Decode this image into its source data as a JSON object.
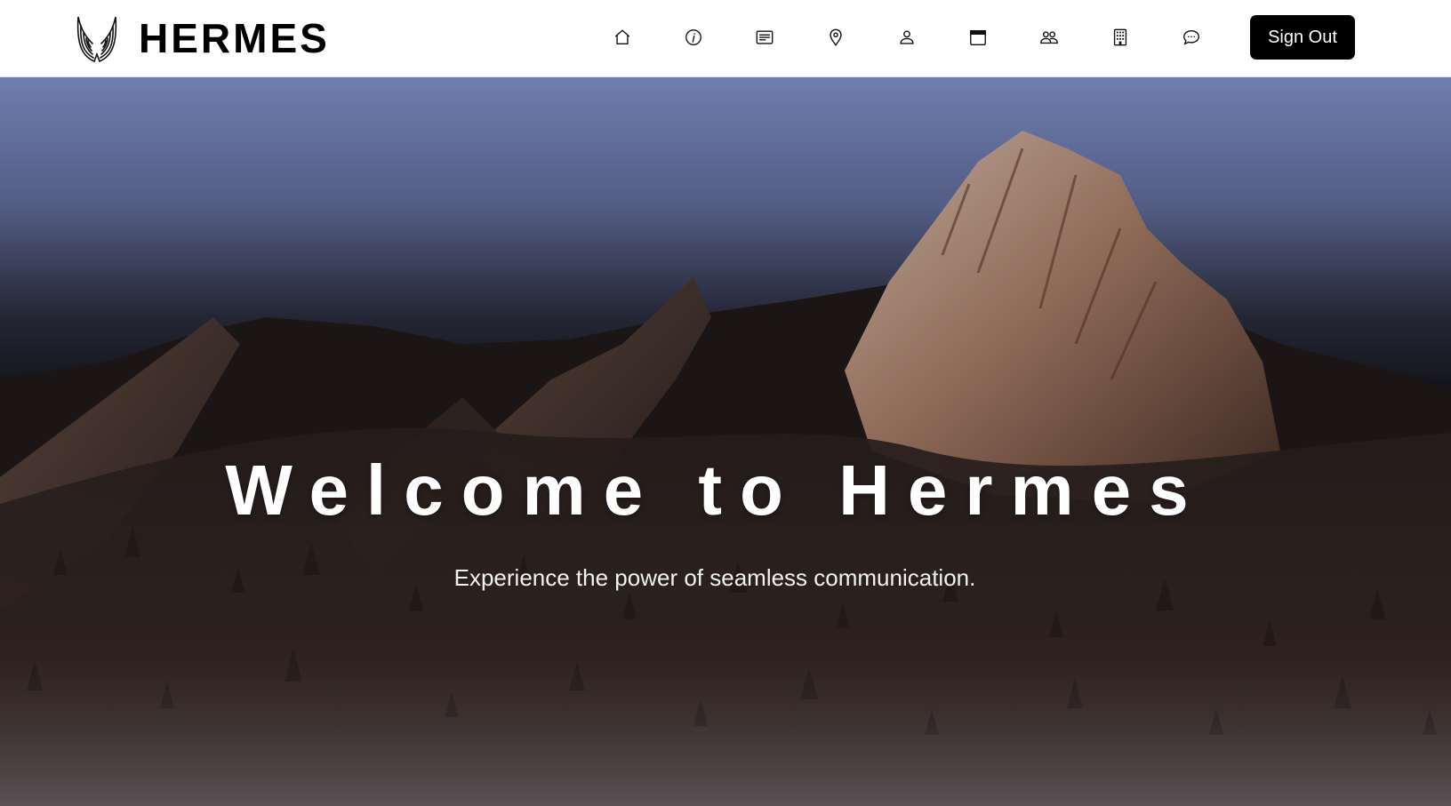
{
  "brand": {
    "name": "HERMES"
  },
  "nav": {
    "icons": [
      "home-icon",
      "info-icon",
      "message-icon",
      "location-pin-icon",
      "user-icon",
      "calendar-icon",
      "group-icon",
      "building-icon",
      "chat-icon"
    ],
    "sign_out_label": "Sign Out"
  },
  "hero": {
    "title": "Welcome to Hermes",
    "subtitle": "Experience the power of seamless communication."
  },
  "colors": {
    "navbar_bg": "#ffffff",
    "button_bg": "#000000",
    "button_text": "#ffffff",
    "hero_text": "#ffffff"
  }
}
